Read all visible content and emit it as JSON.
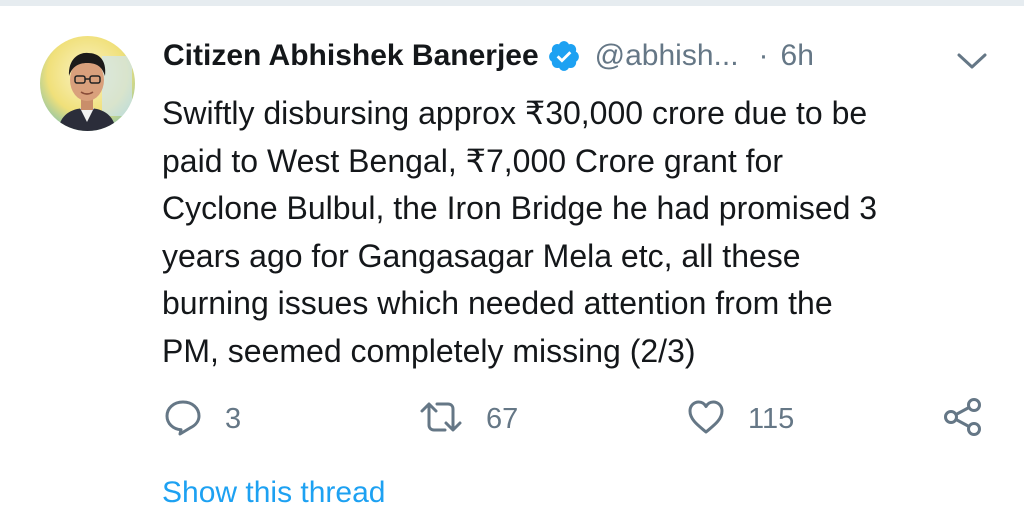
{
  "tweet": {
    "display_name": "Citizen Abhishek Banerjee",
    "handle": "@abhish...",
    "separator": "·",
    "time": "6h",
    "text": "Swiftly disbursing approx ₹30,000 crore due to be\npaid to West Bengal, ₹7,000 Crore grant for\nCyclone Bulbul, the Iron Bridge he had promised 3\nyears ago for Gangasagar Mela etc, all these\nburning issues which needed attention from the\nPM, seemed completely missing (2/3)",
    "reply_count": "3",
    "retweet_count": "67",
    "like_count": "115",
    "show_thread_label": "Show this thread"
  },
  "icons": {
    "verified": "verified-badge-icon",
    "caret": "chevron-down-icon",
    "reply": "reply-icon",
    "retweet": "retweet-icon",
    "like": "heart-icon",
    "share": "share-icon"
  },
  "colors": {
    "text": "#14171a",
    "secondary": "#657786",
    "accent": "#1da1f2",
    "divider": "#e6ecf0"
  }
}
